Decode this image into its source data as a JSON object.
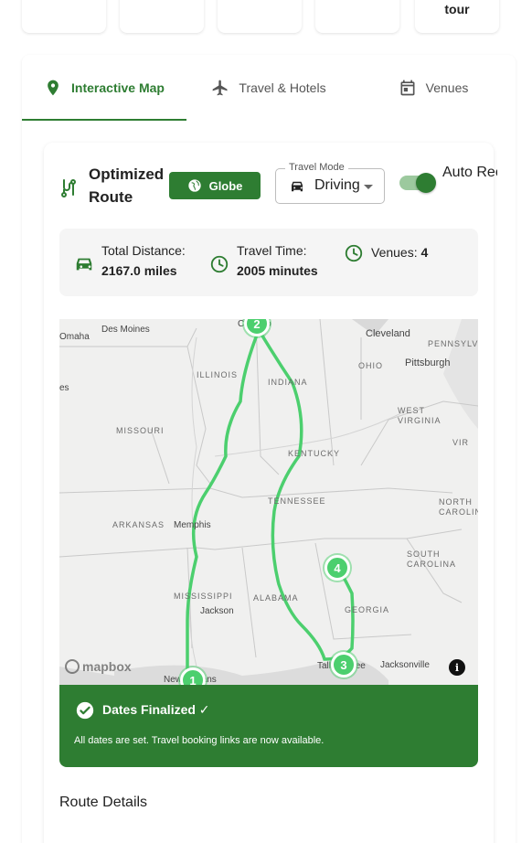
{
  "top_cards": {
    "last_label": "tour"
  },
  "tabs": [
    {
      "label": "Interactive Map",
      "icon": "map-pin-icon",
      "active": true
    },
    {
      "label": "Travel & Hotels",
      "icon": "airplane-icon",
      "active": false
    },
    {
      "label": "Venues",
      "icon": "calendar-icon",
      "active": false
    }
  ],
  "route": {
    "title": "Optimized Route",
    "globe_label": "Globe",
    "travel_mode_label": "Travel Mode",
    "travel_mode_value": "Driving",
    "auto_label": "Auto Recalculate"
  },
  "stats": {
    "distance_label": "Total Distance:",
    "distance_value": "2167.0 miles",
    "time_label": "Travel Time:",
    "time_value": "2005 minutes",
    "venues_label": "Venues:",
    "venues_value": "4"
  },
  "map": {
    "states": [
      "ILLINOIS",
      "INDIANA",
      "OHIO",
      "MISSOURI",
      "KENTUCKY",
      "WEST VIRGINIA",
      "TENNESSEE",
      "NORTH CAROLINA",
      "ARKANSAS",
      "SOUTH CAROLINA",
      "MISSISSIPPI",
      "ALABAMA",
      "GEORGIA",
      "PENNSYLV",
      "VIR"
    ],
    "cities": [
      "Des Moines",
      "Omaha",
      "Cleveland",
      "Pittsburgh",
      "Memphis",
      "Jackson",
      "Jacksonville",
      "Tallahassee",
      "New Orleans",
      "Chicago",
      "es"
    ],
    "markers": [
      "1",
      "2",
      "3",
      "4"
    ],
    "attribution": "mapbox",
    "info": "i",
    "route_color": "#4ccf6e"
  },
  "alert": {
    "title": "Dates Finalized ✓",
    "text": "All dates are set. Travel booking links are now available."
  },
  "details": {
    "title": "Route Details"
  },
  "colors": {
    "accent": "#2e7d32"
  }
}
